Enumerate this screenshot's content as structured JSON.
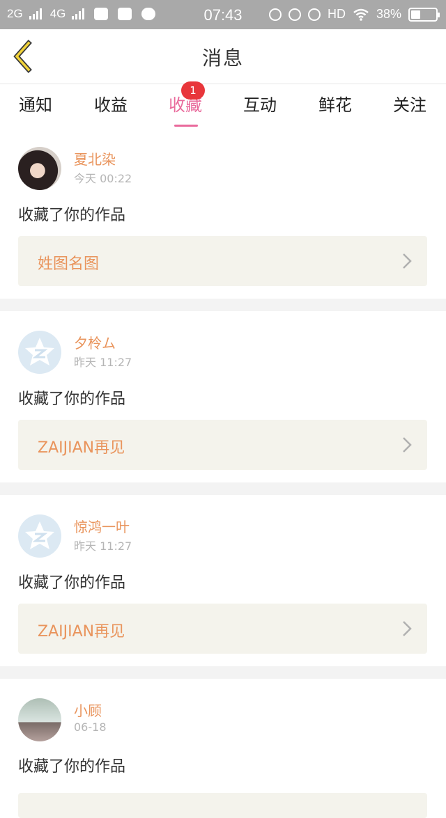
{
  "status_bar": {
    "network_left": "2G",
    "network_right": "4G",
    "time": "07:43",
    "hd": "HD",
    "battery": "38%",
    "battery_level": 0.38
  },
  "header": {
    "title": "消息"
  },
  "tabs": [
    {
      "label": "通知"
    },
    {
      "label": "收益"
    },
    {
      "label": "收藏",
      "active": true,
      "badge": "1"
    },
    {
      "label": "互动"
    },
    {
      "label": "鲜花"
    },
    {
      "label": "关注"
    }
  ],
  "messages": [
    {
      "user": "夏北染",
      "time": "今天 00:22",
      "action": "收藏了你的作品",
      "work": "姓图名图",
      "avatar": "photo"
    },
    {
      "user": "夕柃ム",
      "time": "昨天 11:27",
      "action": "收藏了你的作品",
      "work": "ZAIJIAN再见",
      "avatar": "default"
    },
    {
      "user": "惊鸿一叶",
      "time": "昨天 11:27",
      "action": "收藏了你的作品",
      "work": "ZAIJIAN再见",
      "avatar": "default"
    },
    {
      "user": "小顾",
      "time": "06-18",
      "action": "收藏了你的作品",
      "work": "",
      "avatar": "photo"
    }
  ],
  "colors": {
    "accent_pink": "#e96a9c",
    "username_orange": "#e9945c",
    "badge_red": "#e8363b",
    "card_bg": "#f4f3ec"
  },
  "icons": {
    "back": "chevron-left-icon",
    "row_arrow": "chevron-right-icon",
    "default_avatar": "qzone-star-icon"
  }
}
